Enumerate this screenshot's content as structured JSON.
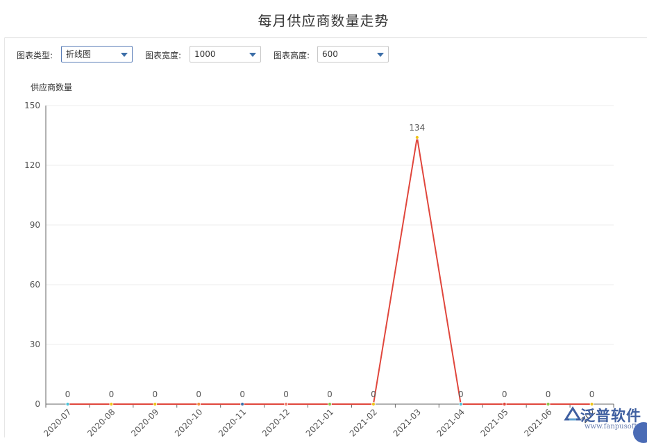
{
  "page": {
    "title": "每月供应商数量走势"
  },
  "toolbar": {
    "chart_type_label": "图表类型:",
    "chart_type_value": "折线图",
    "chart_width_label": "图表宽度:",
    "chart_width_value": "1000",
    "chart_height_label": "图表高度:",
    "chart_height_value": "600"
  },
  "icons": {
    "dropdown": "chevron-down-icon"
  },
  "watermark": {
    "brand_text": "泛普软件",
    "url_text": "www.fanpusoft.com"
  },
  "chart_data": {
    "type": "line",
    "title": "",
    "xlabel": "",
    "ylabel": "供应商数量",
    "ylim": [
      0,
      150
    ],
    "yticks": [
      0,
      30,
      60,
      90,
      120,
      150
    ],
    "grid": true,
    "categories": [
      "2020-07",
      "2020-08",
      "2020-09",
      "2020-10",
      "2020-11",
      "2020-12",
      "2021-01",
      "2021-02",
      "2021-03",
      "2021-04",
      "2021-05",
      "2021-06",
      "2021-07"
    ],
    "visible_categories": [
      "2020-07",
      "2020-08",
      "2020-09",
      "2020-10",
      "2020-11",
      "2020-12",
      "2021-01",
      "2021-02",
      "2021-03",
      "2021-04",
      "2021-05",
      "2021-06",
      "202"
    ],
    "values": [
      0,
      0,
      0,
      0,
      0,
      0,
      0,
      0,
      134,
      0,
      0,
      0,
      0
    ],
    "data_labels": [
      "0",
      "0",
      "0",
      "0",
      "0",
      "0",
      "0",
      "0",
      "134",
      "0",
      "0",
      "0",
      "0"
    ],
    "line_color": "#e0463c",
    "point_colors": [
      "#4cc3d9",
      "#f0c419",
      "#f0c419",
      "#f08c3c",
      "#3c6ea8",
      "#f07c6c",
      "#8cc34c",
      "#f0c419",
      "#f0c419",
      "#4cc3d9",
      "#e0463c",
      "#8cc34c",
      "#f0c419"
    ]
  }
}
